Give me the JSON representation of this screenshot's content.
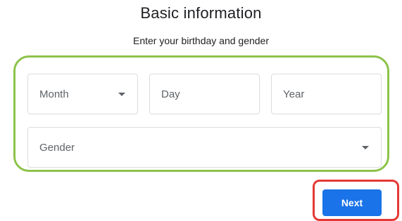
{
  "header": {
    "title": "Basic information",
    "subtitle": "Enter your birthday and gender"
  },
  "form": {
    "month": {
      "placeholder": "Month",
      "icon": "chevron-down-icon"
    },
    "day": {
      "placeholder": "Day"
    },
    "year": {
      "placeholder": "Year"
    },
    "gender": {
      "placeholder": "Gender",
      "icon": "chevron-down-icon"
    }
  },
  "actions": {
    "next_label": "Next"
  },
  "colors": {
    "accent": "#1a73e8",
    "highlight_green": "#8cc34a",
    "highlight_red": "#e53935",
    "field_border": "#dadce0"
  }
}
